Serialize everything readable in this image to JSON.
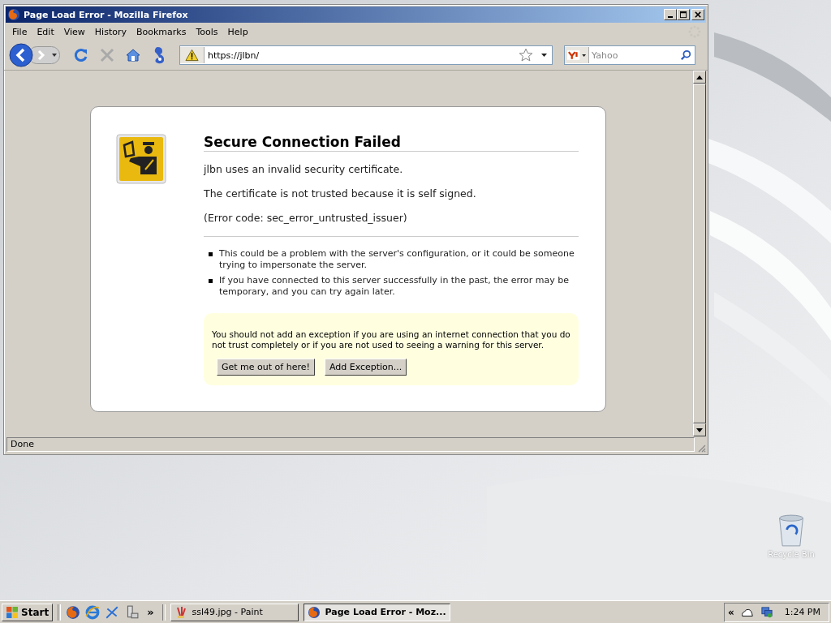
{
  "window": {
    "title": "Page Load Error - Mozilla Firefox"
  },
  "menu": [
    "File",
    "Edit",
    "View",
    "History",
    "Bookmarks",
    "Tools",
    "Help"
  ],
  "nav_buttons": [
    {
      "kind": "back",
      "disabled": false
    },
    {
      "kind": "forward",
      "disabled": true
    },
    {
      "kind": "reload",
      "disabled": false
    },
    {
      "kind": "stop",
      "disabled": true
    },
    {
      "kind": "home",
      "disabled": false
    },
    {
      "kind": "addon",
      "disabled": false
    }
  ],
  "address": {
    "value": "https://jlbn/"
  },
  "search": {
    "placeholder": "Yahoo"
  },
  "error_page": {
    "title": "Secure Connection Failed",
    "paragraphs": [
      "jlbn uses an invalid security certificate.",
      "The certificate is not trusted because it is self signed.",
      "(Error code: sec_error_untrusted_issuer)"
    ],
    "bullets": [
      "This could be a problem with the server's configuration, or it could be someone trying to impersonate the server.",
      "If you have connected to this server successfully in the past, the error may be temporary, and you can try again later."
    ],
    "warning": {
      "text": "You should not add an exception if you are using an internet connection that you do not trust completely or if you are not used to seeing a warning for this server.",
      "buttons": [
        "Get me out of here!",
        "Add Exception..."
      ]
    }
  },
  "status_bar": {
    "text": "Done"
  },
  "desktop": {
    "recycle_bin": "Recycle Bin"
  },
  "taskbar": {
    "start": "Start",
    "overflow": "»",
    "tasks": [
      {
        "label": "ssl49.jpg - Paint",
        "kind": "paint",
        "selected": false
      },
      {
        "label": "Page Load Error - Moz...",
        "kind": "firefox",
        "selected": true
      }
    ],
    "tray_overflow": "«",
    "clock": "1:24 PM"
  }
}
